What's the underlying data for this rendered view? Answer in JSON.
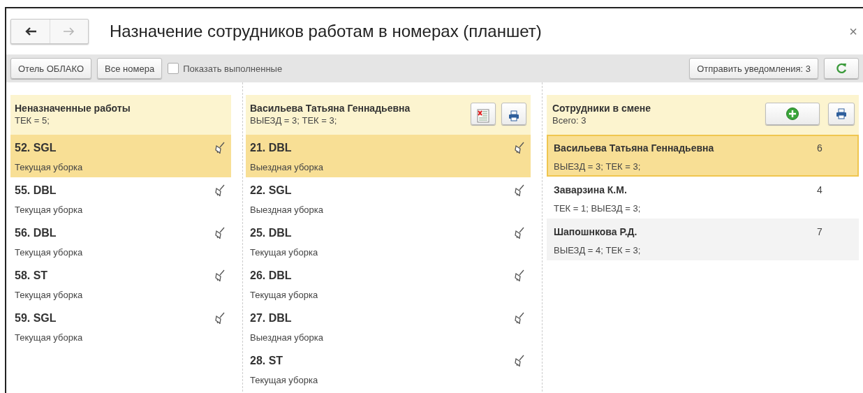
{
  "window": {
    "title": "Назначение сотрудников работам в номерах (планшет)",
    "close": "×"
  },
  "nav": [
    {
      "kind": "back",
      "disabled": false
    },
    {
      "kind": "forward",
      "disabled": true
    }
  ],
  "toolbar": {
    "buttons": [
      "Отель ОБЛАКО",
      "Все номера"
    ],
    "checkbox": {
      "label": "Показать выполненные",
      "checked": false
    },
    "notify_button": "Отправить уведомления: 3"
  },
  "unassigned": {
    "title": "Неназначенные работы",
    "summary": "ТЕК = 5;",
    "items": [
      {
        "title": "52. SGL",
        "subtitle": "Текущая уборка",
        "selected": true
      },
      {
        "title": "55. DBL",
        "subtitle": "Текущая уборка",
        "selected": false
      },
      {
        "title": "56. DBL",
        "subtitle": "Текущая уборка",
        "selected": false
      },
      {
        "title": "58. ST",
        "subtitle": "Текущая уборка",
        "selected": false
      },
      {
        "title": "59. SGL",
        "subtitle": "Текущая уборка",
        "selected": false
      }
    ]
  },
  "employee_works": {
    "title": "Васильева Татьяна Геннадьевна",
    "summary": "ВЫЕЗД = 3; ТЕК = 3;",
    "items": [
      {
        "title": "21. DBL",
        "subtitle": "Выездная уборка",
        "selected": true
      },
      {
        "title": "22. SGL",
        "subtitle": "Выездная уборка",
        "selected": false
      },
      {
        "title": "25. DBL",
        "subtitle": "Текущая уборка",
        "selected": false
      },
      {
        "title": "26. DBL",
        "subtitle": "Текущая уборка",
        "selected": false
      },
      {
        "title": "27. DBL",
        "subtitle": "Выездная уборка",
        "selected": false
      },
      {
        "title": "28. ST",
        "subtitle": "Текущая уборка",
        "selected": false
      }
    ]
  },
  "staff": {
    "title": "Сотрудники в смене",
    "summary": "Всего: 3",
    "employees": [
      {
        "name": "Васильева Татьяна Геннадьевна",
        "count": "6",
        "summary": "ВЫЕЗД = 3; ТЕК = 3;",
        "selected": true
      },
      {
        "name": "Заварзина К.М.",
        "count": "4",
        "summary": "ТЕК = 1; ВЫЕЗД = 3;",
        "selected": false
      },
      {
        "name": "Шапошнкова Р.Д.",
        "count": "7",
        "summary": "ВЫЕЗД = 4; ТЕК = 3;",
        "selected": false
      }
    ]
  }
}
